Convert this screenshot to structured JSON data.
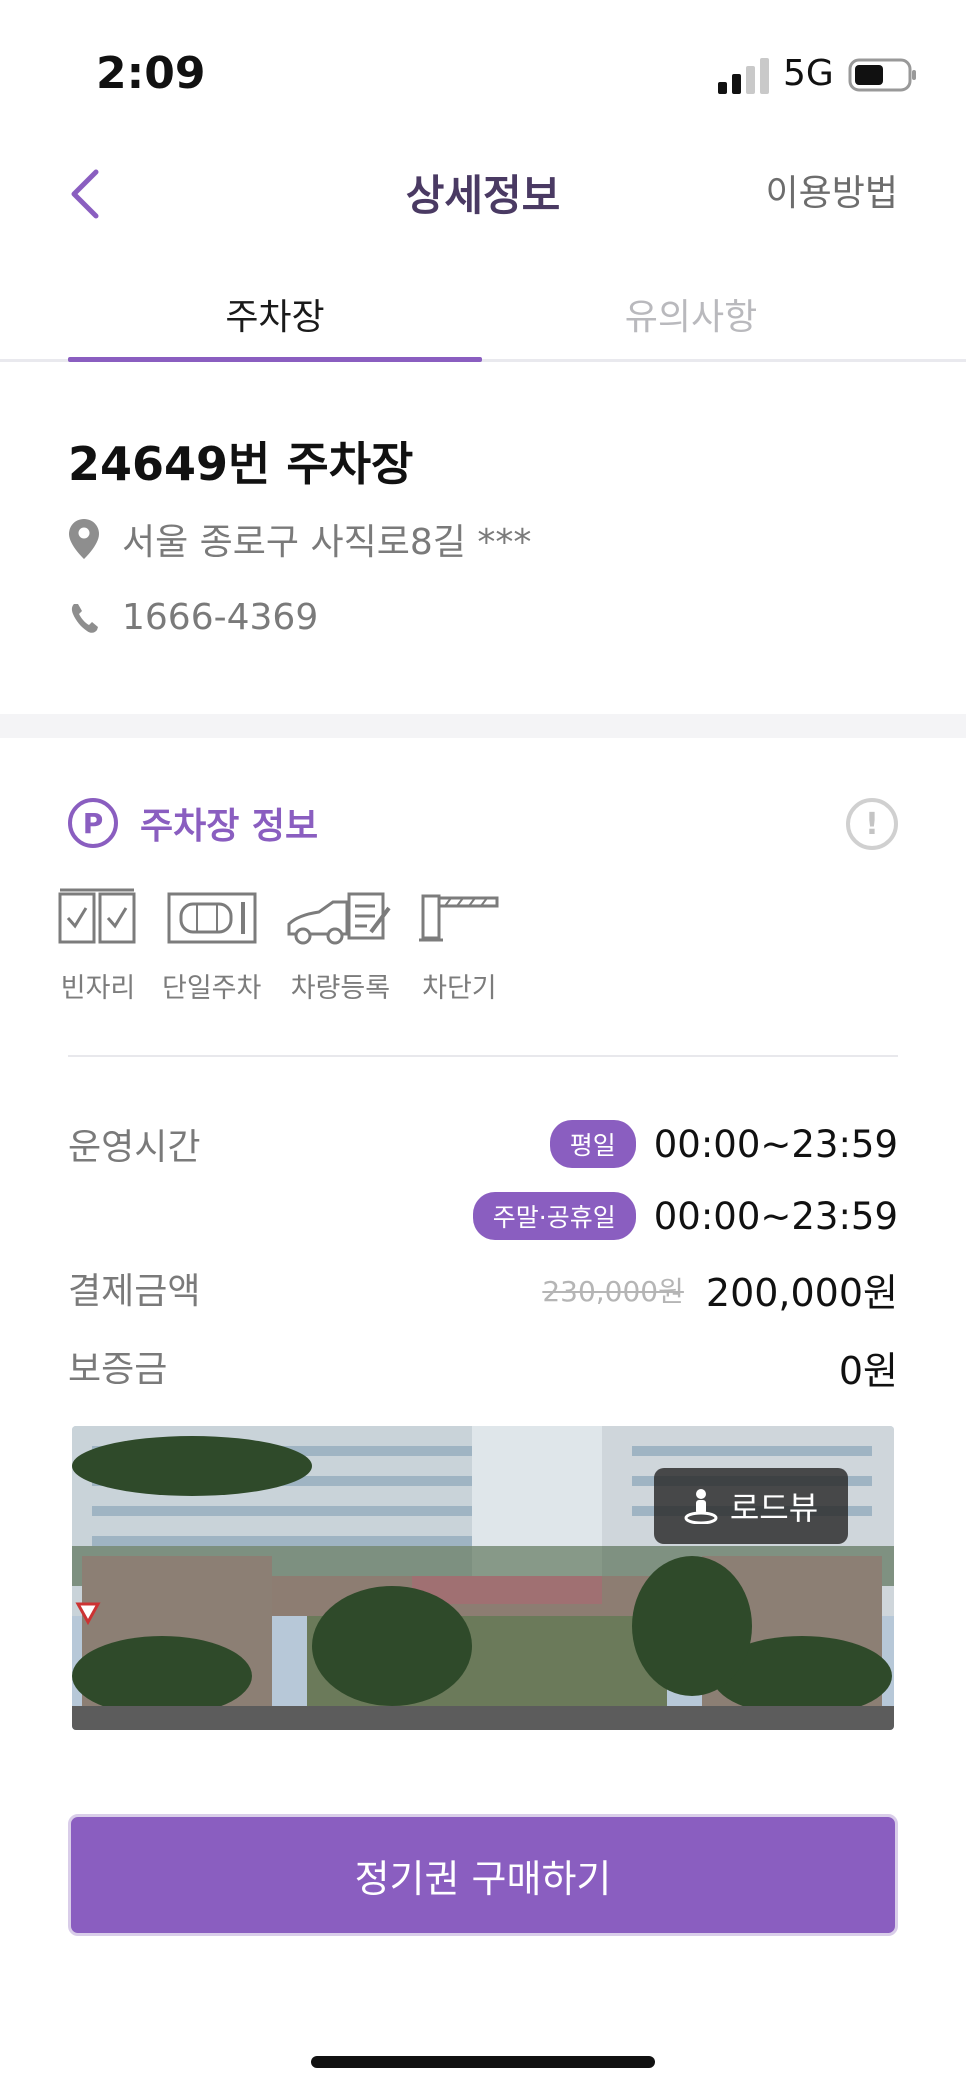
{
  "status_bar": {
    "time": "2:09",
    "network": "5G"
  },
  "nav": {
    "title": "상세정보",
    "help_link": "이용방법"
  },
  "tabs": [
    {
      "label": "주차장",
      "active": true
    },
    {
      "label": "유의사항",
      "active": false
    }
  ],
  "lot": {
    "name": "24649번 주차장",
    "address": "서울 종로구 사직로8길 ***",
    "phone": "1666-4369"
  },
  "section": {
    "icon_letter": "P",
    "title": "주차장 정보",
    "alert_symbol": "!"
  },
  "features": [
    {
      "label": "빈자리",
      "icon": "checkbox-grid-icon"
    },
    {
      "label": "단일주차",
      "icon": "single-parking-icon"
    },
    {
      "label": "차량등록",
      "icon": "car-registration-icon"
    },
    {
      "label": "차단기",
      "icon": "barrier-gate-icon"
    }
  ],
  "details": {
    "hours_label": "운영시간",
    "weekday_badge": "평일",
    "weekday_hours": "00:00~23:59",
    "weekend_badge": "주말·공휴일",
    "weekend_hours": "00:00~23:59",
    "payment_label": "결제금액",
    "original_price": "230,000원",
    "price": "200,000원",
    "deposit_label": "보증금",
    "deposit": "0원"
  },
  "roadview": {
    "label": "로드뷰"
  },
  "cta": {
    "label": "정기권 구매하기"
  },
  "colors": {
    "accent": "#8a5ec0",
    "title": "#4a3a63"
  }
}
